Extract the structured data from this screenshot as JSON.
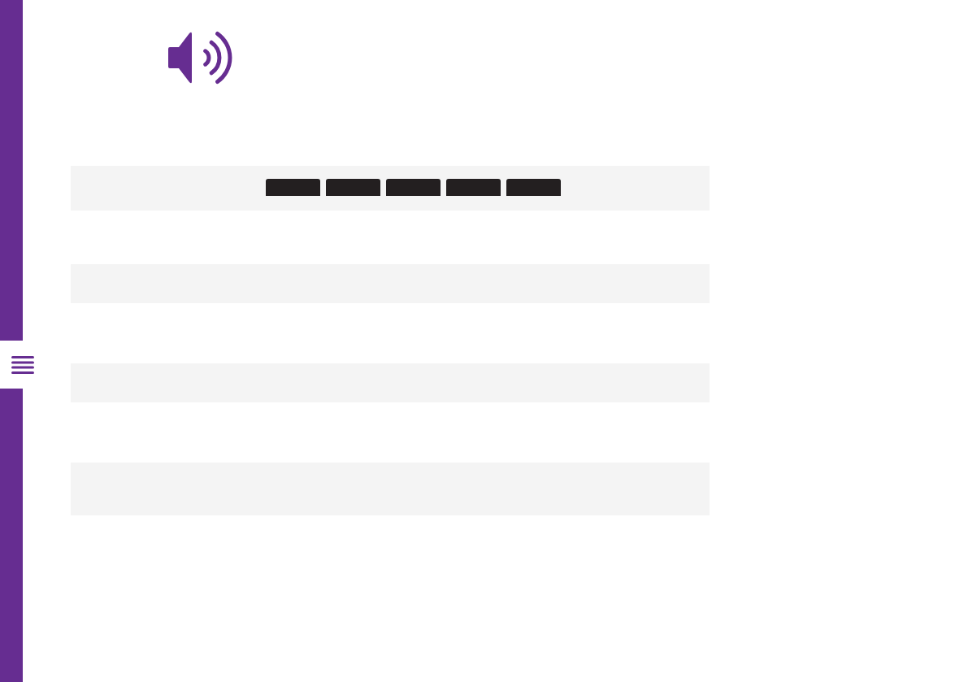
{
  "sidebar": {
    "menu_button": {
      "kind": "menu"
    }
  },
  "header_icon": {
    "kind": "speaker"
  },
  "rows": [
    {
      "kind": "header",
      "blocks": [
        {
          "kind": "bar"
        },
        {
          "kind": "bar"
        },
        {
          "kind": "bar"
        },
        {
          "kind": "bar"
        },
        {
          "kind": "bar"
        }
      ]
    },
    {
      "kind": "plain"
    },
    {
      "kind": "plain"
    },
    {
      "kind": "tall"
    }
  ]
}
